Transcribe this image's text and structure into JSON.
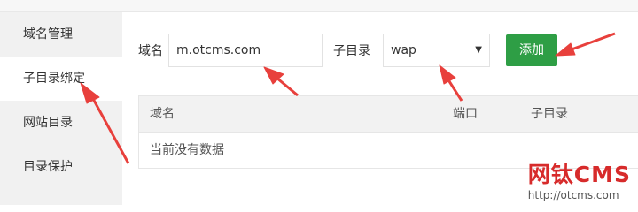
{
  "sidebar": {
    "items": [
      {
        "label": "域名管理"
      },
      {
        "label": "子目录绑定"
      },
      {
        "label": "网站目录"
      },
      {
        "label": "目录保护"
      }
    ]
  },
  "form": {
    "domain_label": "域名",
    "domain_value": "m.otcms.com",
    "subdir_label": "子目录",
    "subdir_selected": "wap",
    "add_label": "添加"
  },
  "table": {
    "headers": [
      "域名",
      "端口",
      "子目录"
    ],
    "empty_text": "当前没有数据"
  },
  "watermark": {
    "title": "网钛CMS",
    "url": "http://otcms.com"
  },
  "colors": {
    "accent_green": "#2e9e45",
    "annotation_red": "#e8403c"
  }
}
